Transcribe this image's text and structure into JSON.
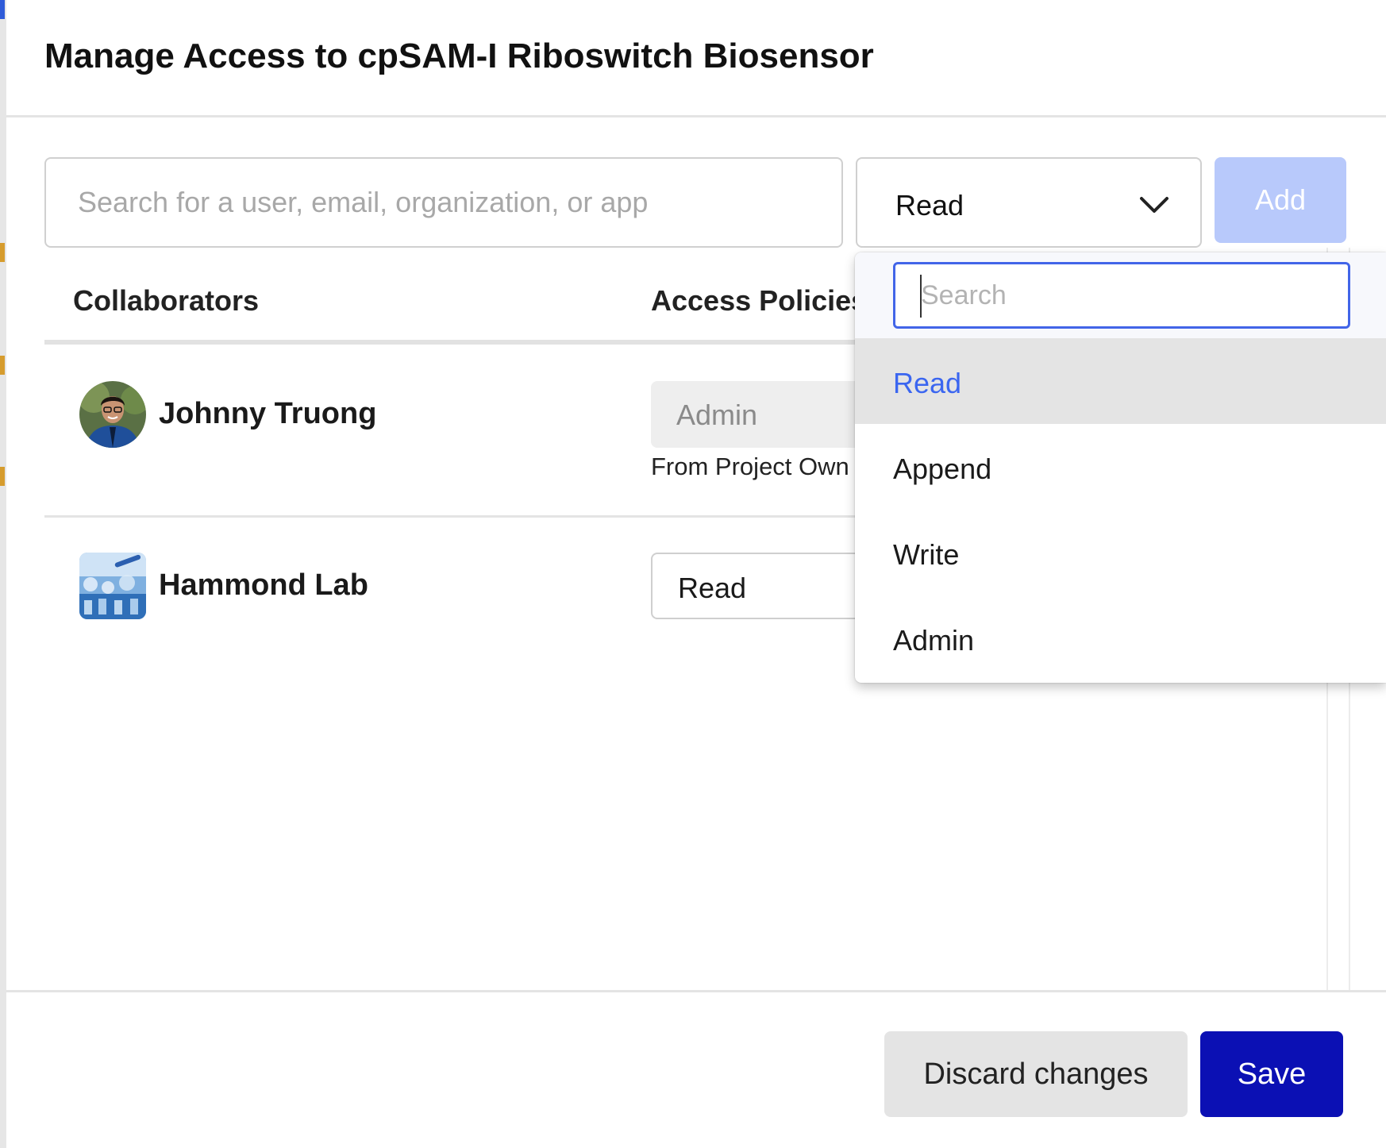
{
  "dialog": {
    "title": "Manage Access to cpSAM-I Riboswitch Biosensor"
  },
  "invite": {
    "search_placeholder": "Search for a user, email, organization, or app",
    "role_value": "Read",
    "add_label": "Add"
  },
  "table": {
    "headers": {
      "collaborators": "Collaborators",
      "access_policies": "Access Policies"
    },
    "rows": [
      {
        "name": "Johnny Truong",
        "policy": "Admin",
        "note": "From Project Own"
      },
      {
        "name": "Hammond Lab",
        "policy": "Read"
      }
    ]
  },
  "dropdown": {
    "search_placeholder": "Search",
    "options": [
      "Read",
      "Append",
      "Write",
      "Admin"
    ],
    "selected": "Read"
  },
  "footer": {
    "discard_label": "Discard changes",
    "save_label": "Save"
  },
  "colors": {
    "save_button": "#0b10b4",
    "add_button_disabled": "#b8c9fb",
    "selected_option_text": "#3b66f0",
    "dropdown_search_border": "#4265e8"
  },
  "icons": {
    "role_select": "chevron-down-icon",
    "avatar_1": "user-avatar",
    "avatar_2": "org-avatar"
  }
}
